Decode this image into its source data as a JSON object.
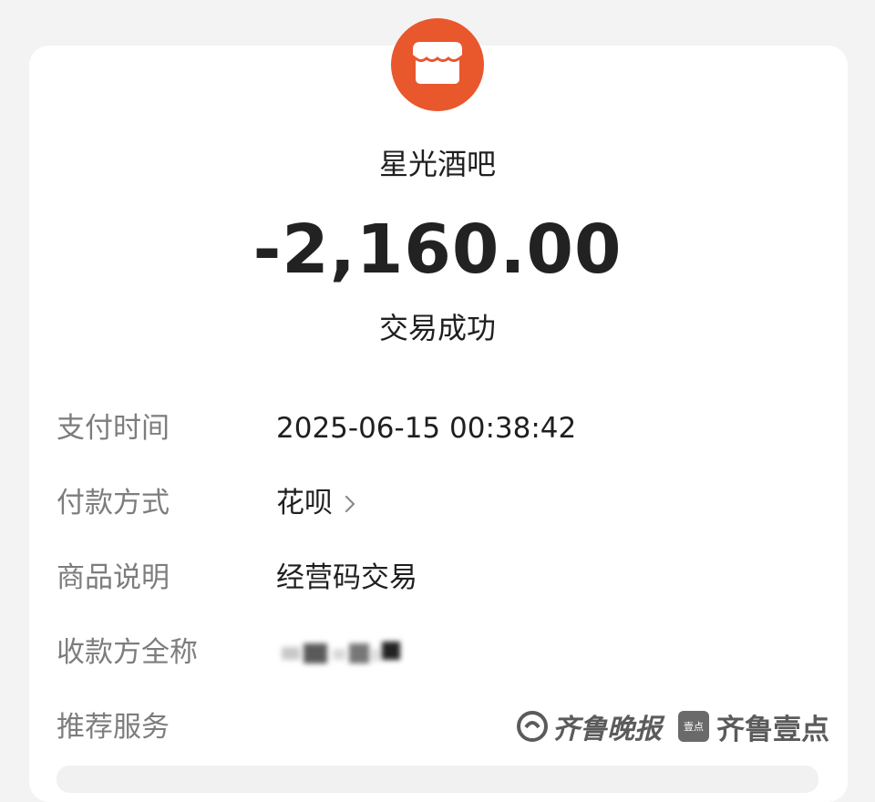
{
  "merchant": {
    "icon": "shop-icon",
    "icon_color": "#e9572d",
    "name": "星光酒吧"
  },
  "transaction": {
    "amount": "-2,160.00",
    "status": "交易成功"
  },
  "details": [
    {
      "label": "支付时间",
      "value": "2025-06-15 00:38:42"
    },
    {
      "label": "付款方式",
      "value": "花呗",
      "icon": "chevron-right-icon"
    },
    {
      "label": "商品说明",
      "value": "经营码交易"
    },
    {
      "label": "收款方全称",
      "value": ""
    },
    {
      "label": "推荐服务",
      "value": ""
    }
  ],
  "watermark": {
    "logo_text": "齐鲁晚报",
    "box_text": "壹点",
    "brand_text": "齐鲁壹点"
  }
}
